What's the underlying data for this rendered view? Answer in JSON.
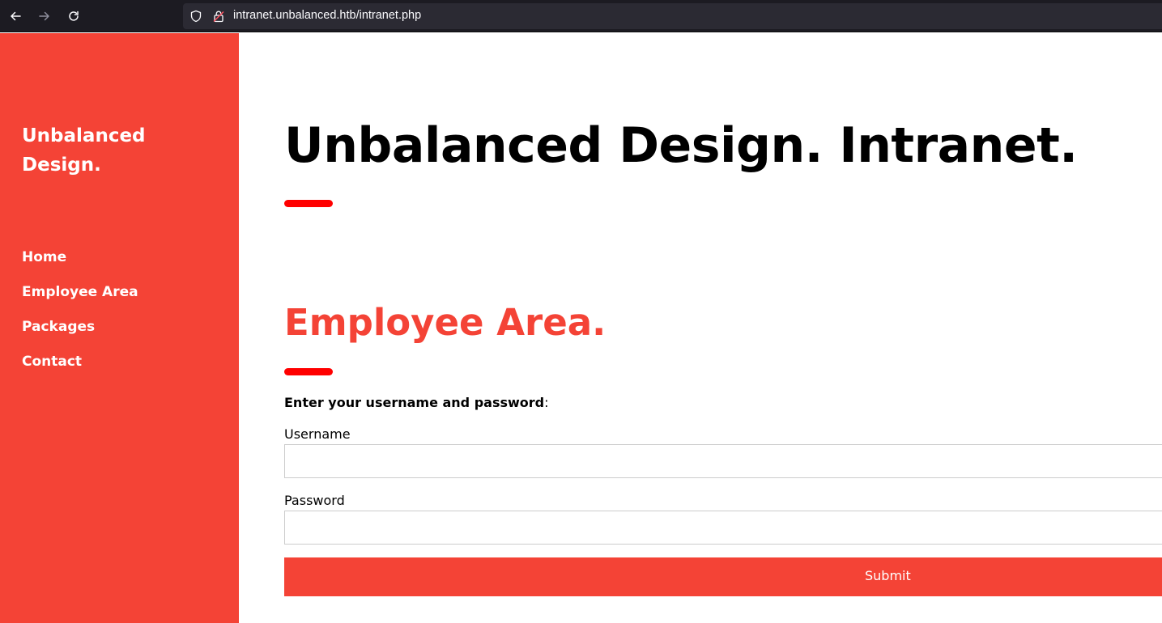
{
  "browser": {
    "url": "intranet.unbalanced.htb/intranet.php",
    "icons": {
      "back": "arrow-left-icon",
      "forward": "arrow-right-icon",
      "reload": "reload-icon",
      "shield": "shield-icon",
      "lock": "lock-icon"
    }
  },
  "sidebar": {
    "brand_line1": "Unbalanced",
    "brand_line2": "Design.",
    "items": [
      {
        "label": "Home"
      },
      {
        "label": "Employee Area"
      },
      {
        "label": "Packages"
      },
      {
        "label": "Contact"
      }
    ]
  },
  "main": {
    "title": "Unbalanced Design. Intranet.",
    "section_title": "Employee Area.",
    "instruction_bold": "Enter your username and password",
    "instruction_suffix": ":",
    "username_label": "Username",
    "username_value": "",
    "password_label": "Password",
    "password_value": "",
    "submit_label": "Submit"
  },
  "colors": {
    "accent": "#f44336",
    "bar": "#ff0000",
    "browser_bg": "#1c1b22",
    "urlbar_bg": "#2b2a33"
  }
}
